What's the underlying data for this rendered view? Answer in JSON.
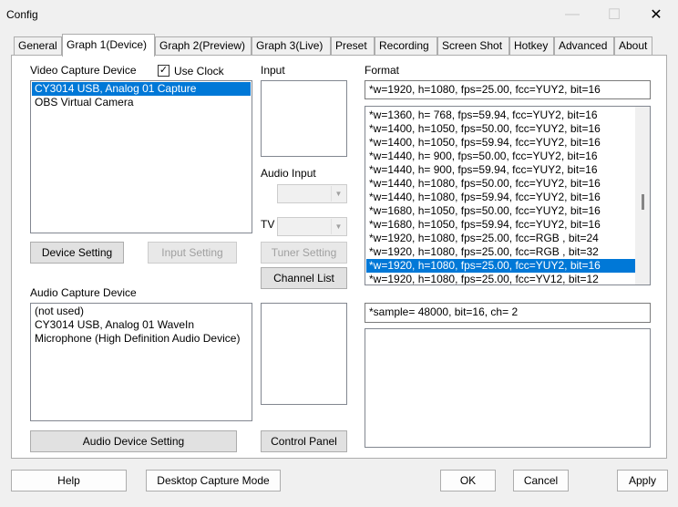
{
  "window": {
    "title": "Config",
    "minimize_icon": "minimize-icon",
    "maximize_icon": "maximize-icon",
    "close_icon": "close-icon"
  },
  "tabs": [
    {
      "label": "General"
    },
    {
      "label": "Graph 1(Device)"
    },
    {
      "label": "Graph 2(Preview)"
    },
    {
      "label": "Graph 3(Live)"
    },
    {
      "label": "Preset"
    },
    {
      "label": "Recording"
    },
    {
      "label": "Screen Shot"
    },
    {
      "label": "Hotkey"
    },
    {
      "label": "Advanced"
    },
    {
      "label": "About"
    }
  ],
  "active_tab": "Graph 1(Device)",
  "video_capture": {
    "label": "Video Capture Device",
    "use_clock_label": "Use Clock",
    "use_clock_checked": true,
    "items": [
      "CY3014 USB, Analog 01 Capture",
      "OBS Virtual Camera"
    ],
    "selected": "CY3014 USB, Analog 01 Capture",
    "device_setting_button": "Device Setting"
  },
  "input": {
    "label": "Input",
    "input_setting_button": "Input Setting",
    "audio_input_label": "Audio Input",
    "tv_label": "TV",
    "tuner_setting_button": "Tuner Setting",
    "channel_list_button": "Channel List"
  },
  "format": {
    "label": "Format",
    "current": "*w=1920, h=1080, fps=25.00,  fcc=YUY2, bit=16",
    "items": [
      "*w=1360, h= 768, fps=59.94,  fcc=YUY2, bit=16",
      "*w=1400, h=1050, fps=50.00,  fcc=YUY2, bit=16",
      "*w=1400, h=1050, fps=59.94,  fcc=YUY2, bit=16",
      "*w=1440, h= 900, fps=50.00,  fcc=YUY2, bit=16",
      "*w=1440, h= 900, fps=59.94,  fcc=YUY2, bit=16",
      "*w=1440, h=1080, fps=50.00,  fcc=YUY2, bit=16",
      "*w=1440, h=1080, fps=59.94,  fcc=YUY2, bit=16",
      "*w=1680, h=1050, fps=50.00,  fcc=YUY2, bit=16",
      "*w=1680, h=1050, fps=59.94,  fcc=YUY2, bit=16",
      "*w=1920, h=1080, fps=25.00,  fcc=RGB , bit=24",
      "*w=1920, h=1080, fps=25.00,  fcc=RGB , bit=32",
      "*w=1920, h=1080, fps=25.00,  fcc=YUY2, bit=16",
      "*w=1920, h=1080, fps=25.00,  fcc=YV12, bit=12"
    ],
    "selected_index": 11,
    "scroll_position": 0.78
  },
  "audio_capture": {
    "label": "Audio Capture Device",
    "items": [
      "(not used)",
      "CY3014 USB, Analog 01 WaveIn",
      "Microphone (High Definition Audio Device)"
    ],
    "audio_device_setting_button": "Audio Device Setting",
    "control_panel_button": "Control Panel",
    "audio_format": "*sample= 48000, bit=16, ch= 2"
  },
  "bottom": {
    "help": "Help",
    "desktop_capture_mode": "Desktop Capture Mode",
    "ok": "OK",
    "cancel": "Cancel",
    "apply": "Apply"
  },
  "colors": {
    "selection": "#0078d7",
    "window_bg": "#f0f0f0"
  }
}
